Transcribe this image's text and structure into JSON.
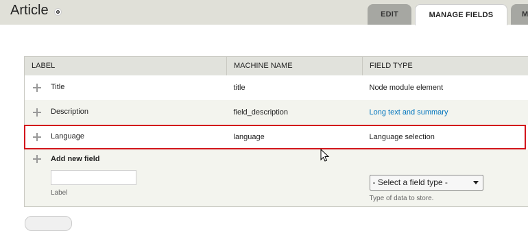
{
  "header": {
    "title": "Article"
  },
  "tabs": [
    {
      "label": "Edit",
      "active": false
    },
    {
      "label": "Manage fields",
      "active": true
    },
    {
      "label": "M",
      "active": false
    }
  ],
  "table": {
    "columns": [
      "Label",
      "Machine name",
      "Field type"
    ],
    "rows": [
      {
        "label": "Title",
        "machine_name": "title",
        "field_type": "Node module element",
        "field_type_is_link": false
      },
      {
        "label": "Description",
        "machine_name": "field_description",
        "field_type": "Long text and summary",
        "field_type_is_link": true
      },
      {
        "label": "Language",
        "machine_name": "language",
        "field_type": "Language selection",
        "field_type_is_link": false
      }
    ],
    "add_new": {
      "title": "Add new field",
      "label_input_value": "",
      "label_description": "Label",
      "select_value": "- Select a field type -",
      "select_description": "Type of data to store."
    }
  },
  "colors": {
    "header_bg": "#e0e0d8",
    "highlight": "#d3151b",
    "link": "#0074bd"
  }
}
